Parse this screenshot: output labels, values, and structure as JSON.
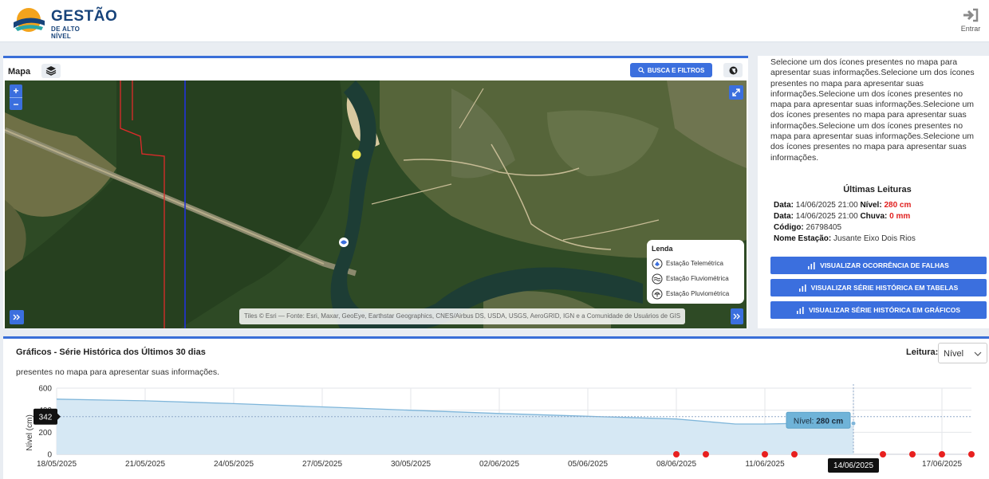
{
  "header": {
    "logo_line1": "GESTÃO",
    "logo_line2": "DE ALTO NÍVEL",
    "login_label": "Entrar"
  },
  "map": {
    "title": "Mapa",
    "search_button": "BUSCA E FILTROS",
    "zoom_in": "+",
    "zoom_out": "−",
    "attribution": "Tiles © Esri — Fonte: Esri, Maxar, GeoEye, Earthstar Geographics, CNES/Airbus DS, USDA, USGS, AeroGRID, IGN e a Comunidade de Usuários de GIS",
    "legend": {
      "title": "Lenda",
      "items": [
        "Estação Telemétrica",
        "Estação Fluviométrica",
        "Estação Pluviométrica"
      ]
    }
  },
  "info": {
    "text": "Selecione um dos ícones presentes no mapa para apresentar suas informações.Selecione um dos ícones presentes no mapa para apresentar suas informações.Selecione um dos ícones presentes no mapa para apresentar suas informações.Selecione um dos ícones presentes no mapa para apresentar suas informações.Selecione um dos ícones presentes no mapa para apresentar suas informações.Selecione um dos ícones presentes no mapa para apresentar suas informações.",
    "readings_title": "Últimas Leituras",
    "data_label": "Data:",
    "row1_date": "14/06/2025 21:00",
    "row1_kind": "Nível:",
    "row1_value": "280 cm",
    "row2_date": "14/06/2025 21:00",
    "row2_kind": "Chuva:",
    "row2_value": "0 mm",
    "code_label": "Código:",
    "code_value": "26798405",
    "station_label": "Nome Estação:",
    "station_value": "Jusante Eixo Dois Rios",
    "btn_falhas": "VISUALIZAR OCORRÊNCIA DE FALHAS",
    "btn_tabelas": "VISUALIZAR SÉRIE HISTÓRICA EM TABELAS",
    "btn_graficos": "VISUALIZAR SÉRIE HISTÓRICA EM GRÁFICOS"
  },
  "chart_panel": {
    "title": "Gráficos - Série Histórica dos Últimos 30 dias",
    "leitura_label": "Leitura:",
    "leitura_value": "Nível",
    "subtitle": "presentes no mapa para apresentar suas informações.",
    "crosshair_value": "342",
    "tooltip_label": "Nível:",
    "tooltip_value": "280 cm",
    "crosshair_date": "14/06/2025"
  },
  "chart_data": {
    "type": "area",
    "ylabel": "Nível (cm)",
    "ylim": [
      0,
      600
    ],
    "yticks": [
      0,
      200,
      400,
      600
    ],
    "xticks": [
      "18/05/2025",
      "21/05/2025",
      "24/05/2025",
      "27/05/2025",
      "30/05/2025",
      "02/06/2025",
      "05/06/2025",
      "08/06/2025",
      "11/06/2025",
      "14/06/2025",
      "17/06/2025"
    ],
    "series": [
      {
        "x": [
          "2025-05-18",
          "2025-05-21",
          "2025-05-24",
          "2025-05-27",
          "2025-05-30",
          "2025-06-02",
          "2025-06-05",
          "2025-06-08",
          "2025-06-10",
          "2025-06-11",
          "2025-06-12",
          "2025-06-13",
          "2025-06-14"
        ],
        "values": [
          500,
          485,
          460,
          430,
          400,
          370,
          345,
          320,
          275,
          275,
          280,
          280,
          280
        ],
        "color": "#7fb6da"
      }
    ],
    "failure_markers": {
      "x": [
        "2025-06-08",
        "2025-06-09",
        "2025-06-11",
        "2025-06-12",
        "2025-06-15",
        "2025-06-16",
        "2025-06-17",
        "2025-06-18"
      ],
      "color": "#e8201f"
    },
    "grid": true
  }
}
